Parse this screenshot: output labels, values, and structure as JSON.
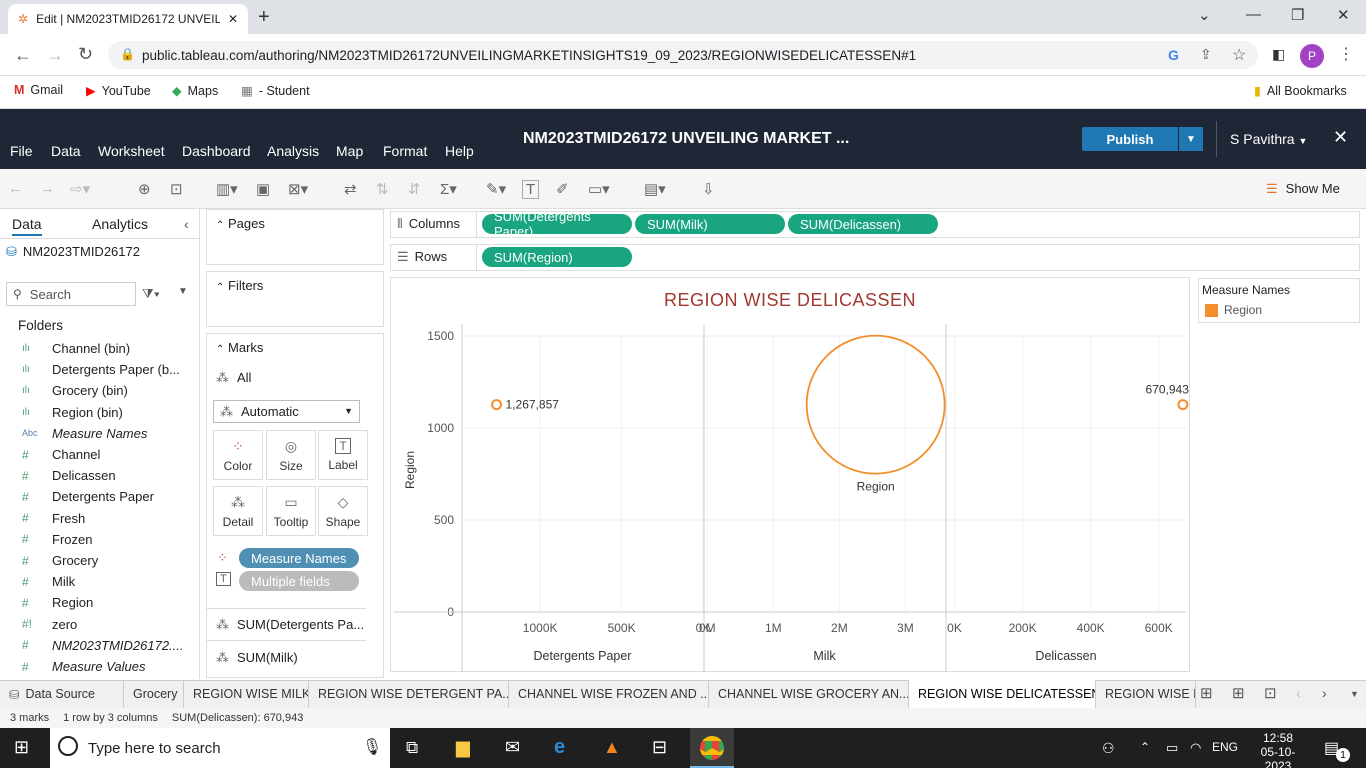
{
  "browser": {
    "tab_title": "Edit | NM2023TMID26172 UNVEIL",
    "url": "public.tableau.com/authoring/NM2023TMID26172UNVEILINGMARKETINSIGHTS19_09_2023/REGIONWISEDELICATESSEN#1",
    "bookmarks": [
      "Gmail",
      "YouTube",
      "Maps",
      "- Student"
    ],
    "all_bookmarks": "All Bookmarks",
    "profile_initial": "P"
  },
  "app": {
    "menu": [
      "File",
      "Data",
      "Worksheet",
      "Dashboard",
      "Analysis",
      "Map",
      "Format",
      "Help"
    ],
    "workbook_title": "NM2023TMID26172 UNVEILING MARKET ...",
    "publish": "Publish",
    "user": "S Pavithra",
    "show_me": "Show Me"
  },
  "data_pane": {
    "tabs": [
      "Data",
      "Analytics"
    ],
    "datasource": "NM2023TMID26172",
    "search_placeholder": "Search",
    "folders_label": "Folders",
    "fields": [
      {
        "icon": "bin",
        "name": "Channel (bin)",
        "italic": false
      },
      {
        "icon": "bin",
        "name": "Detergents Paper (b...",
        "italic": false
      },
      {
        "icon": "bin",
        "name": "Grocery (bin)",
        "italic": false
      },
      {
        "icon": "bin",
        "name": "Region (bin)",
        "italic": false
      },
      {
        "icon": "abc",
        "name": "Measure Names",
        "italic": true
      },
      {
        "icon": "measure",
        "name": "Channel",
        "italic": false
      },
      {
        "icon": "measure",
        "name": "Delicassen",
        "italic": false
      },
      {
        "icon": "measure",
        "name": "Detergents Paper",
        "italic": false
      },
      {
        "icon": "measure",
        "name": "Fresh",
        "italic": false
      },
      {
        "icon": "measure",
        "name": "Frozen",
        "italic": false
      },
      {
        "icon": "measure",
        "name": "Grocery",
        "italic": false
      },
      {
        "icon": "measure",
        "name": "Milk",
        "italic": false
      },
      {
        "icon": "measure",
        "name": "Region",
        "italic": false
      },
      {
        "icon": "calc",
        "name": "zero",
        "italic": false
      },
      {
        "icon": "measure",
        "name": "NM2023TMID26172....",
        "italic": true
      },
      {
        "icon": "measure",
        "name": "Measure Values",
        "italic": true
      }
    ]
  },
  "shelves": {
    "pages": "Pages",
    "filters": "Filters",
    "marks": "Marks",
    "marks_all": "All",
    "mark_type": "Automatic",
    "mark_buttons": [
      "Color",
      "Size",
      "Label",
      "Detail",
      "Tooltip",
      "Shape"
    ],
    "mark_pills": [
      "Measure Names",
      "Multiple fields"
    ],
    "mark_sections": [
      "SUM(Detergents Pa...",
      "SUM(Milk)"
    ],
    "columns_label": "Columns",
    "rows_label": "Rows",
    "columns": [
      "SUM(Detergents Paper)",
      "SUM(Milk)",
      "SUM(Delicassen)"
    ],
    "rows": [
      "SUM(Region)"
    ]
  },
  "chart_data": {
    "type": "scatter",
    "title": "REGION WISE DELICASSEN",
    "ylabel": "Region",
    "y_ticks": [
      "1500",
      "1000",
      "500",
      "0"
    ],
    "panes": [
      {
        "xlabel": "Detergents Paper",
        "x_ticks": [
          "1000K",
          "500K",
          "0K"
        ],
        "x": 1267857,
        "y": 1127,
        "label": "1,267,857"
      },
      {
        "xlabel": "Milk",
        "x_ticks": [
          "0M",
          "1M",
          "2M",
          "3M"
        ],
        "x": 2550000,
        "y": 1127,
        "label": "Region"
      },
      {
        "xlabel": "Delicassen",
        "x_ticks": [
          "0K",
          "200K",
          "400K",
          "600K"
        ],
        "x": 670943,
        "y": 1127,
        "label": "670,943"
      }
    ],
    "legend": {
      "title": "Measure Names",
      "items": [
        {
          "name": "Region",
          "color": "#f28e2b"
        }
      ]
    }
  },
  "sheets": {
    "data_source": "Data Source",
    "tabs": [
      "Grocery",
      "REGION WISE MILK",
      "REGION WISE DETERGENT PA...",
      "CHANNEL WISE FROZEN AND ...",
      "CHANNEL WISE GROCERY AN...",
      "REGION WISE DELICATESSEN",
      "REGION WISE D"
    ],
    "active": "REGION WISE DELICATESSEN"
  },
  "status": {
    "marks": "3 marks",
    "dims": "1 row by 3 columns",
    "sum": "SUM(Delicassen): 670,943"
  },
  "taskbar": {
    "search_placeholder": "Type here to search",
    "lang": "ENG",
    "time": "12:58",
    "date": "05-10-2023",
    "notif": "1"
  }
}
